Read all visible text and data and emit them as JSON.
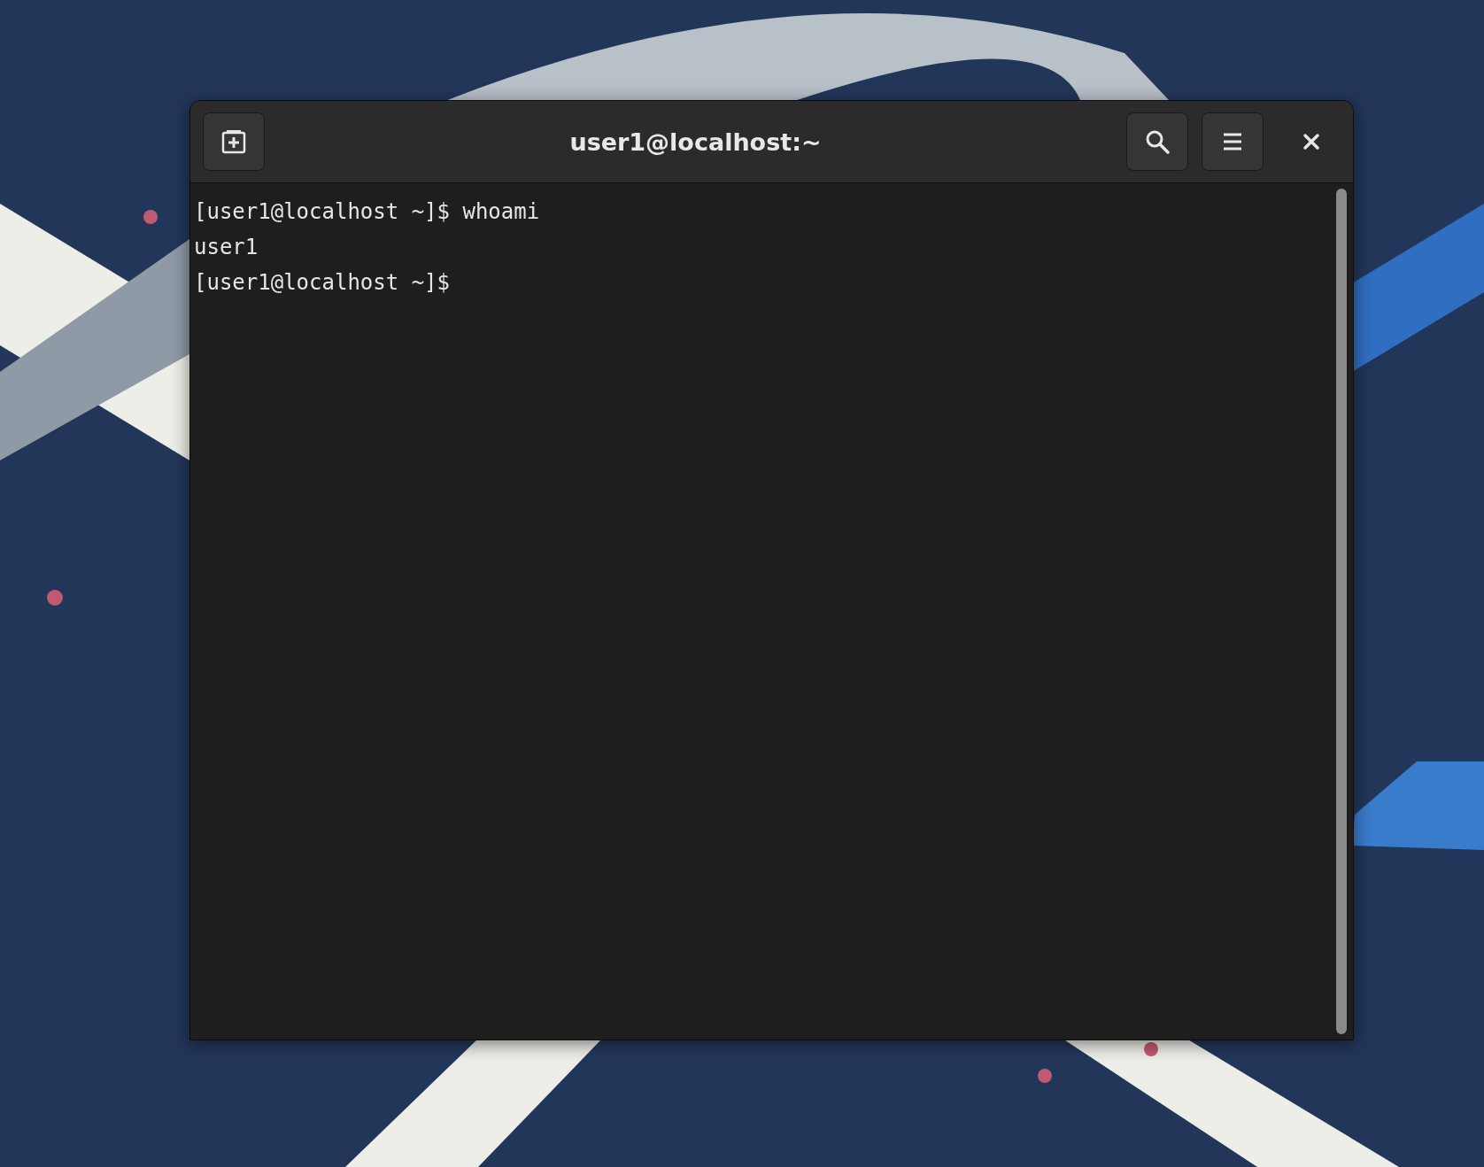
{
  "window": {
    "title": "user1@localhost:~"
  },
  "terminal": {
    "lines": [
      {
        "text": "[user1@localhost ~]$ whoami"
      },
      {
        "text": "user1"
      },
      {
        "text": "[user1@localhost ~]$"
      }
    ]
  }
}
